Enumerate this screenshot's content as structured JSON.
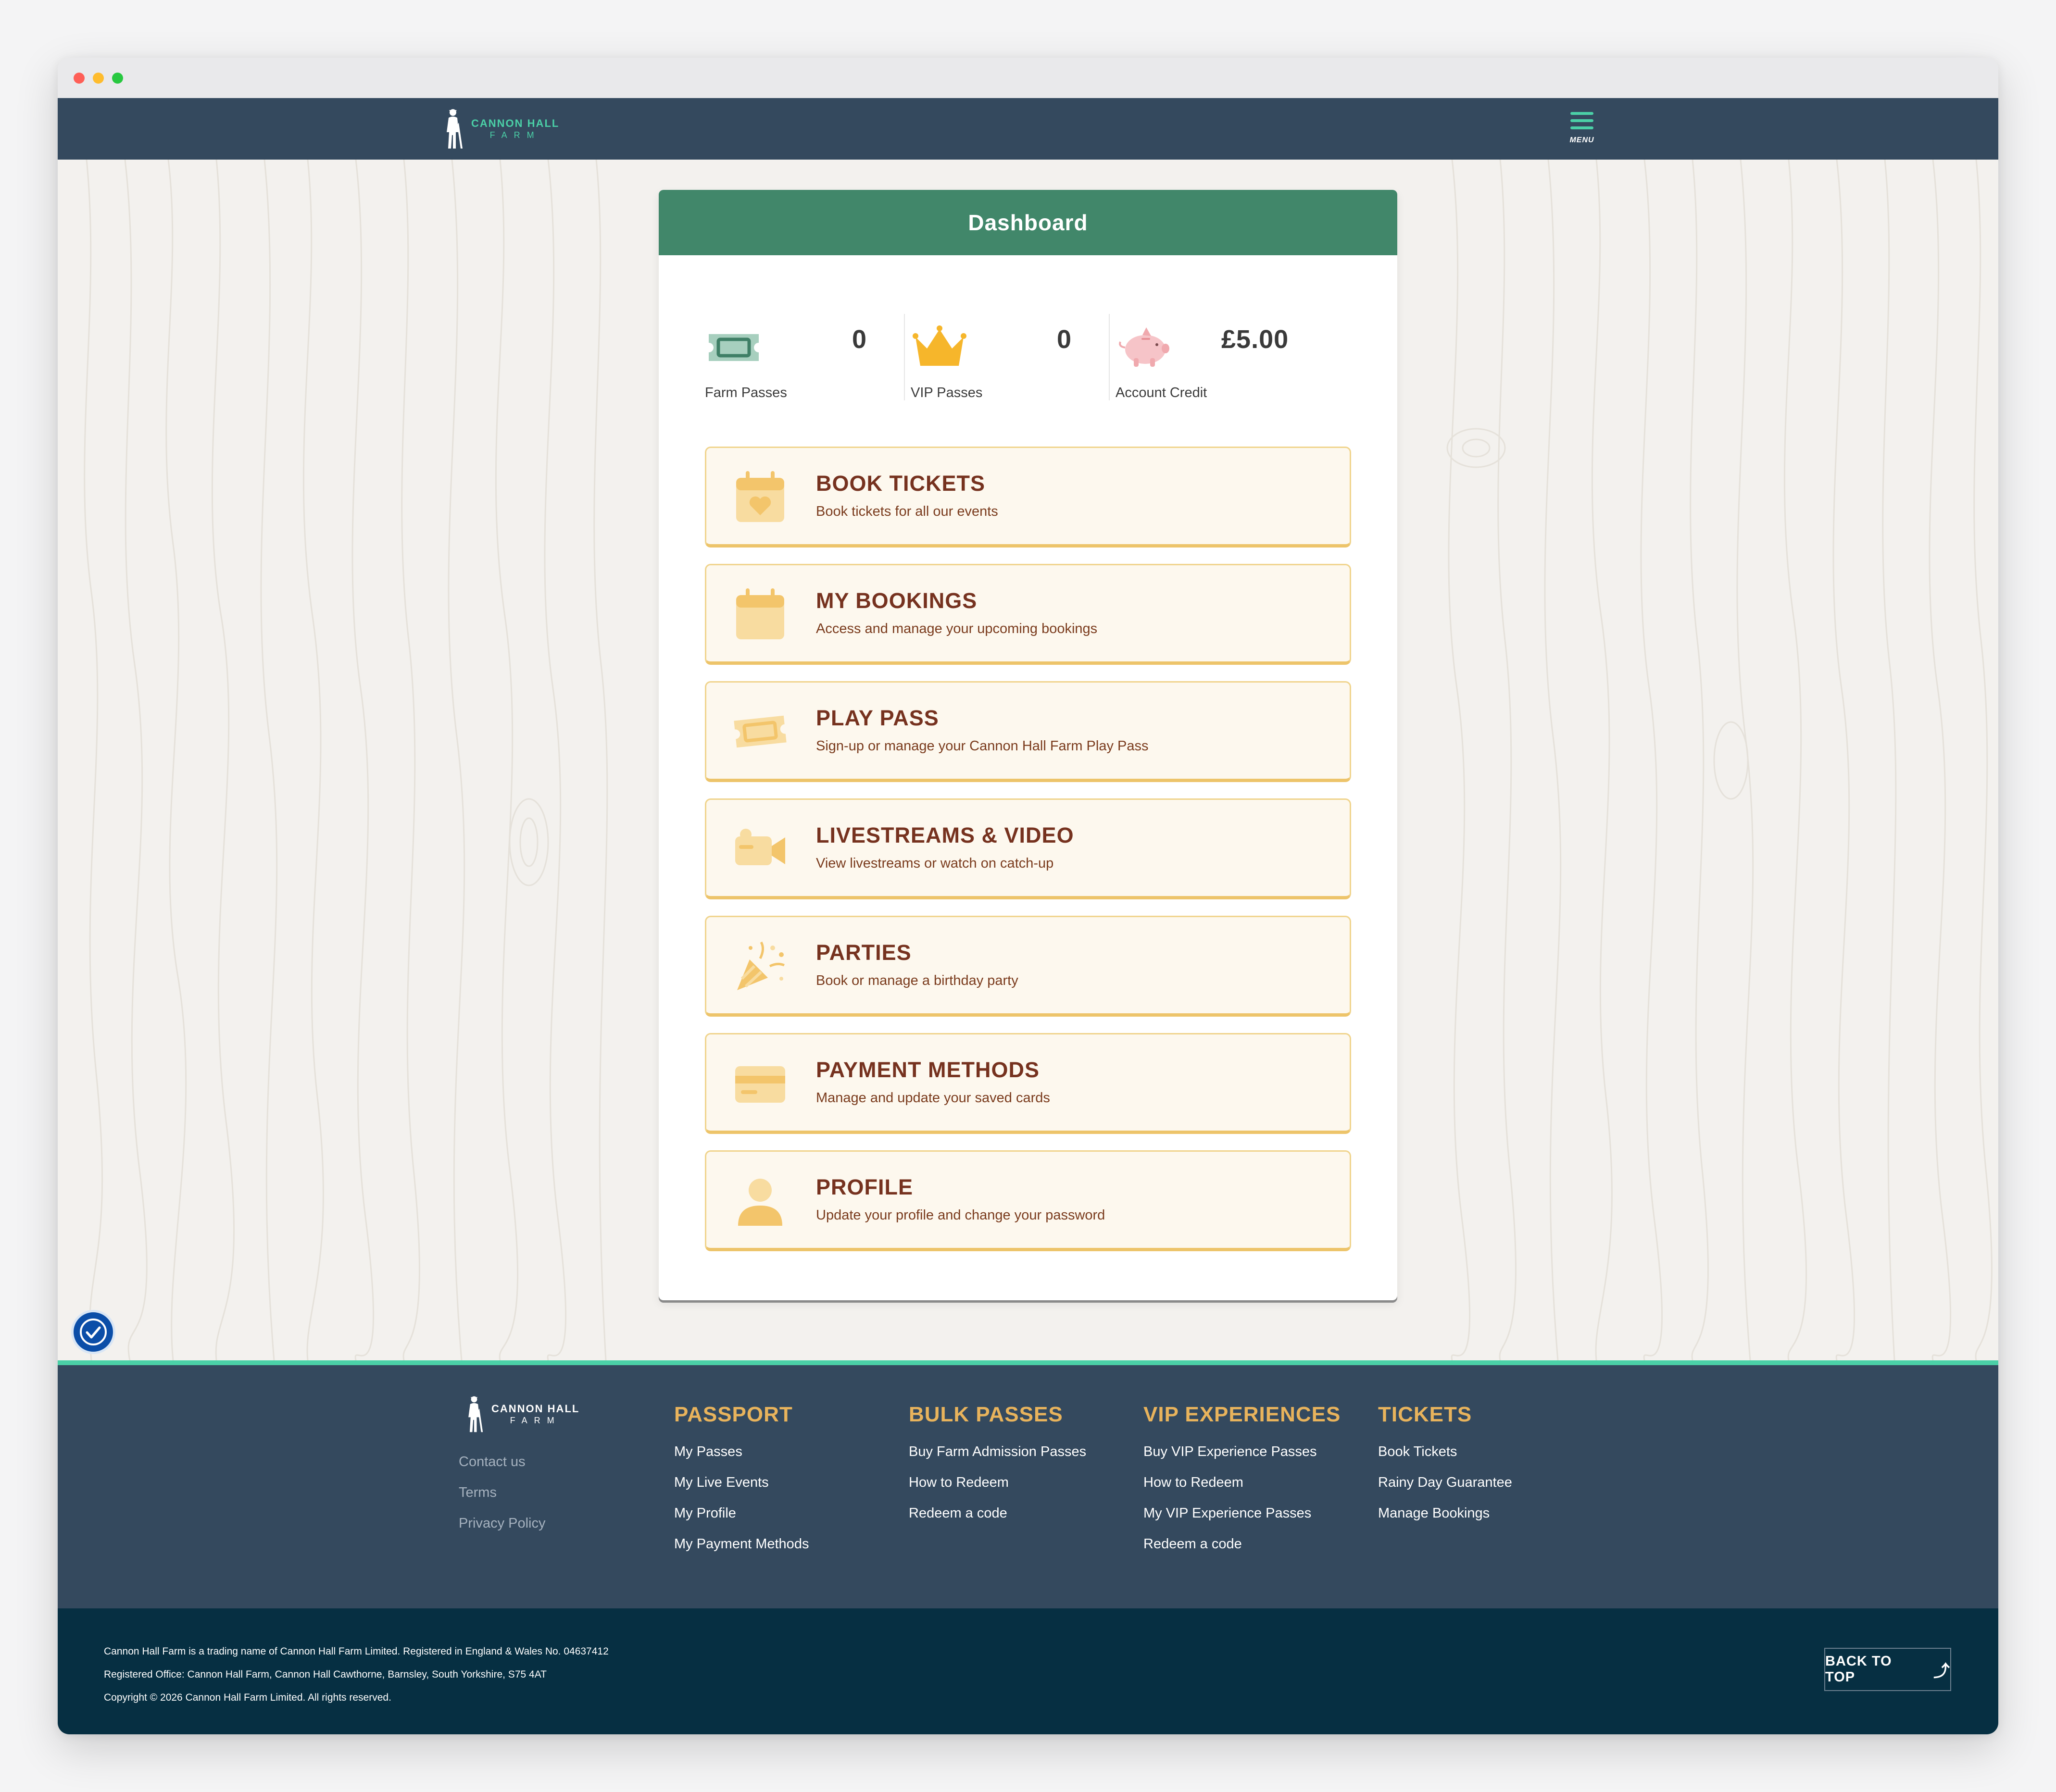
{
  "brand": {
    "line1": "CANNON HALL",
    "line2": "FARM"
  },
  "header": {
    "menu_label": "MENU"
  },
  "dashboard": {
    "title": "Dashboard",
    "stats": [
      {
        "label": "Farm Passes",
        "value": "0",
        "icon": "ticket-icon"
      },
      {
        "label": "VIP Passes",
        "value": "0",
        "icon": "crown-icon"
      },
      {
        "label": "Account Credit",
        "value": "£5.00",
        "icon": "piggy-bank-icon"
      }
    ],
    "tiles": [
      {
        "title": "BOOK TICKETS",
        "subtitle": "Book tickets for all our events",
        "icon": "calendar-heart-icon"
      },
      {
        "title": "MY BOOKINGS",
        "subtitle": "Access and manage your upcoming bookings",
        "icon": "calendar-icon"
      },
      {
        "title": "PLAY PASS",
        "subtitle": "Sign-up or manage your Cannon Hall Farm Play Pass",
        "icon": "ticket-icon"
      },
      {
        "title": "LIVESTREAMS & VIDEO",
        "subtitle": "View livestreams or watch on catch-up",
        "icon": "video-camera-icon"
      },
      {
        "title": "PARTIES",
        "subtitle": "Book or manage a birthday party",
        "icon": "party-popper-icon"
      },
      {
        "title": "PAYMENT METHODS",
        "subtitle": "Manage and update your saved cards",
        "icon": "credit-card-icon"
      },
      {
        "title": "PROFILE",
        "subtitle": "Update your profile and change your password",
        "icon": "user-icon"
      }
    ]
  },
  "footer": {
    "left_links": [
      "Contact us",
      "Terms",
      "Privacy Policy"
    ],
    "columns": [
      {
        "heading": "PASSPORT",
        "links": [
          "My Passes",
          "My Live Events",
          "My Profile",
          "My Payment Methods"
        ]
      },
      {
        "heading": "BULK PASSES",
        "links": [
          "Buy Farm Admission Passes",
          "How to Redeem",
          "Redeem a code"
        ]
      },
      {
        "heading": "VIP EXPERIENCES",
        "links": [
          "Buy VIP Experience Passes",
          "How to Redeem",
          "My VIP Experience Passes",
          "Redeem a code"
        ]
      },
      {
        "heading": "TICKETS",
        "links": [
          "Book Tickets",
          "Rainy Day Guarantee",
          "Manage Bookings"
        ]
      }
    ],
    "legal": [
      "Cannon Hall Farm is a trading name of Cannon Hall Farm Limited. Registered in England & Wales No. 04637412",
      "Registered Office: Cannon Hall Farm, Cannon Hall Cawthorne, Barnsley, South Yorkshire, S75 4AT",
      "Copyright © 2026 Cannon Hall Farm Limited. All rights reserved."
    ],
    "back_to_top": "BACK TO TOP"
  },
  "colors": {
    "header_bg": "#34495e",
    "accent_teal": "#4bd0a7",
    "dashboard_green": "#41876a",
    "tile_title": "#76321f",
    "footer_heading": "#e8b35c",
    "bottom_bar": "#062f42"
  }
}
